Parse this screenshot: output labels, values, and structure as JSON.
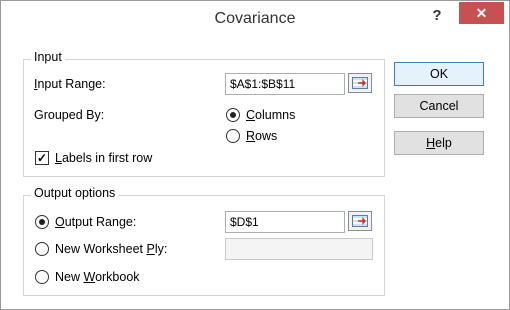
{
  "window": {
    "title": "Covariance",
    "help_glyph": "?",
    "close_glyph": "✕"
  },
  "input_group": {
    "legend": "Input",
    "input_range_label": "Input Range:",
    "input_range_value": "$A$1:$B$11",
    "grouped_by_label": "Grouped By:",
    "columns_label": "Columns",
    "rows_label": "Rows",
    "grouped_by_selected": "Columns",
    "labels_checkbox_label": "Labels in first row",
    "labels_checked": true
  },
  "output_group": {
    "legend": "Output options",
    "output_range_label": "Output Range:",
    "output_range_value": "$D$1",
    "new_worksheet_label": "New Worksheet Ply:",
    "new_worksheet_value": "",
    "new_workbook_label": "New Workbook",
    "selected": "Output Range"
  },
  "buttons": {
    "ok": "OK",
    "cancel": "Cancel",
    "help": "Help"
  },
  "colors": {
    "close_button": "#c75050",
    "default_button_border": "#3c7fb1"
  }
}
